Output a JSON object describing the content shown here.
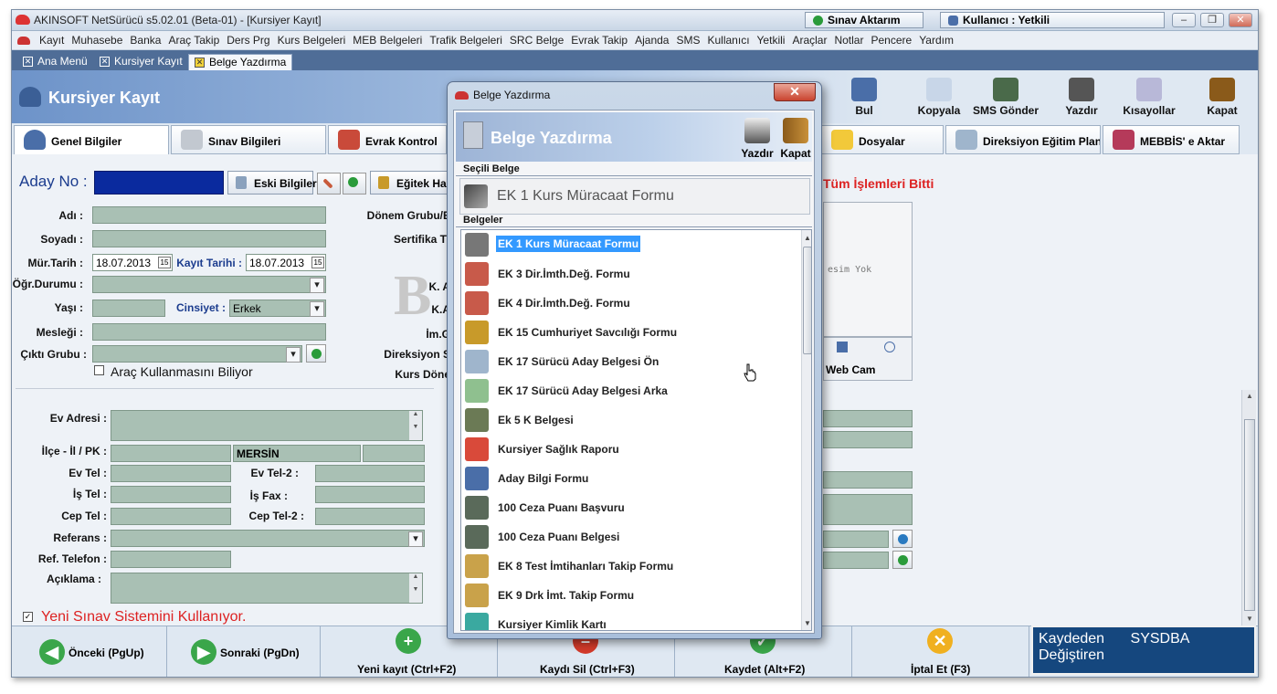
{
  "window": {
    "title": "AKINSOFT NetSürücü s5.02.01 (Beta-01) - [Kursiyer Kayıt]",
    "exam_transfer": "Sınav Aktarım",
    "user": "Kullanıcı : Yetkili",
    "min": "–",
    "max": "❐",
    "close": "✕"
  },
  "menu": [
    "Kayıt",
    "Muhasebe",
    "Banka",
    "Araç Takip",
    "Ders Prg",
    "Kurs Belgeleri",
    "MEB Belgeleri",
    "Trafik Belgeleri",
    "SRC Belge",
    "Evrak Takip",
    "Ajanda",
    "SMS",
    "Kullanıcı",
    "Yetkili",
    "Araçlar",
    "Notlar",
    "Pencere",
    "Yardım"
  ],
  "tabs": [
    "Ana Menü",
    "Kursiyer Kayıt",
    "Belge Yazdırma"
  ],
  "header": {
    "title": "Kursiyer Kayıt"
  },
  "toolbar": [
    {
      "label": "Bul",
      "icon": "find-users-icon"
    },
    {
      "label": "Kopyala",
      "icon": "copy-icon"
    },
    {
      "label": "SMS Gönder",
      "icon": "sms-phone-icon"
    },
    {
      "label": "Yazdır",
      "icon": "printer-icon"
    },
    {
      "label": "Kısayollar",
      "icon": "shortcuts-icon"
    },
    {
      "label": "Kapat",
      "icon": "exit-door-icon"
    }
  ],
  "page_tabs": [
    "Genel Bilgiler",
    "Sınav Bilgileri",
    "Evrak Kontrol",
    "Dosyalar",
    "Direksiyon Eğitim Planı",
    "MEBBİS' e Aktar"
  ],
  "form": {
    "aday_no": "Aday No :",
    "eski_bilgiler": "Eski Bilgiler",
    "egitek": "Eğitek Har",
    "all_done": "Tüm İşlemleri Bitti",
    "adi": "Adı :",
    "soyadi": "Soyadı :",
    "mur_tarih": "Mür.Tarih :",
    "mur_tarih_val": "18.07.2013",
    "kayit_tarih": "Kayıt Tarihi :",
    "kayit_tarih_val": "18.07.2013",
    "ogr_durumu": "Öğr.Durumu :",
    "yasi": "Yaşı :",
    "cinsiyet": "Cinsiyet :",
    "cinsiyet_val": "Erkek",
    "meslegi": "Mesleği :",
    "cikti_grubu": "Çıktı Grubu :",
    "arac_kullanma": "Araç Kullanmasını Biliyor",
    "donem_grubu": "Dönem Grubu/E",
    "sertifika": "Sertifika T",
    "k_a": "K. A",
    "k_a2": "K.A",
    "im_g": "İm.G",
    "direksiyon_s": "Direksiyon S",
    "kurs_donem": "Kurs Döne",
    "resim_yok": "esim Yok",
    "web_cam": "Web Cam",
    "ev_adresi": "Ev Adresi :",
    "ilce": "İlçe - İl / PK :",
    "il_val": "MERSİN",
    "ev_tel": "Ev Tel :",
    "ev_tel2": "Ev Tel-2 :",
    "is_tel": "İş Tel :",
    "is_fax": "İş Fax :",
    "cep_tel": "Cep Tel :",
    "cep_tel2": "Cep Tel-2 :",
    "referans": "Referans :",
    "ref_telefon": "Ref. Telefon :",
    "aciklama": "Açıklama :",
    "yeni_sinav": "Yeni Sınav Sistemini Kullanıyor."
  },
  "bottom": {
    "onceki": "Önceki (PgUp)",
    "sonraki": "Sonraki (PgDn)",
    "yeni": "Yeni kayıt (Ctrl+F2)",
    "sil": "Kaydı Sil (Ctrl+F3)",
    "kaydet": "Kaydet (Alt+F2)",
    "iptal": "İptal Et (F3)",
    "kaydeden_lbl": "Kaydeden",
    "kaydeden_val": "SYSDBA",
    "degistiren_lbl": "Değiştiren"
  },
  "dialog": {
    "title": "Belge Yazdırma",
    "close": "✕",
    "header": "Belge Yazdırma",
    "print": "Yazdır",
    "close_btn": "Kapat",
    "selected_hdr": "Seçili Belge",
    "selected": "EK 1 Kurs Müracaat Formu",
    "list_hdr": "Belgeler",
    "items": [
      {
        "label": "EK 1 Kurs Müracaat Formu",
        "icon": "form-icon",
        "color": "#777"
      },
      {
        "label": "EK 3 Dir.İmth.Değ. Formu",
        "icon": "clipboard-red-icon",
        "color": "#c85a4a"
      },
      {
        "label": "EK 4 Dir.İmth.Değ. Formu",
        "icon": "clipboard-red-icon",
        "color": "#c85a4a"
      },
      {
        "label": "EK 15 Cumhuriyet Savcılığı Formu",
        "icon": "scales-icon",
        "color": "#c89a2a"
      },
      {
        "label": "EK 17 Sürücü Aday Belgesi Ön",
        "icon": "document-icon",
        "color": "#9fb5cc"
      },
      {
        "label": "EK 17 Sürücü Aday Belgesi Arka",
        "icon": "document-refresh-icon",
        "color": "#8fc08f"
      },
      {
        "label": "Ek 5 K Belgesi",
        "icon": "truck-icon",
        "color": "#6b7a55"
      },
      {
        "label": "Kursiyer Sağlık Raporu",
        "icon": "first-aid-icon",
        "color": "#d94a3a"
      },
      {
        "label": "Aday Bilgi Formu",
        "icon": "user-info-icon",
        "color": "#4a6ea8"
      },
      {
        "label": "100 Ceza Puanı Başvuru",
        "icon": "traffic-light-icon",
        "color": "#5a6a5a"
      },
      {
        "label": "100 Ceza Puanı Belgesi",
        "icon": "traffic-light-search-icon",
        "color": "#5a6a5a"
      },
      {
        "label": "EK 8 Test İmtihanları Takip Formu",
        "icon": "clipboard-icon",
        "color": "#c9a24a"
      },
      {
        "label": "EK 9 Drk İmt. Takip Formu",
        "icon": "clipboard-icon",
        "color": "#c9a24a"
      },
      {
        "label": "Kursiyer Kimlik Kartı",
        "icon": "id-card-icon",
        "color": "#3aa9a0"
      }
    ]
  }
}
